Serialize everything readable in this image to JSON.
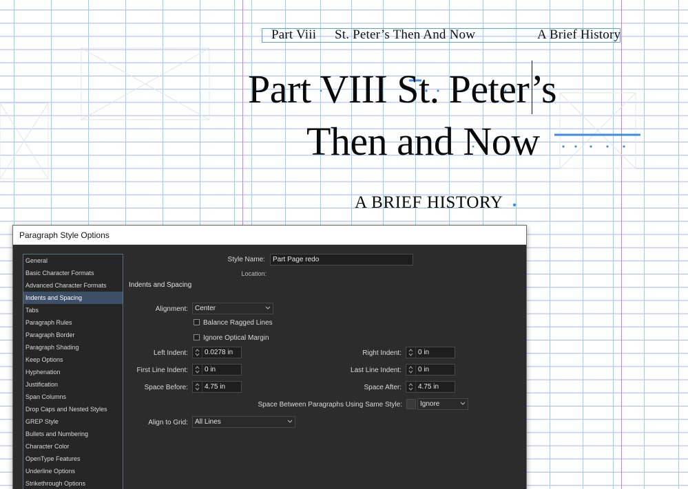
{
  "document": {
    "running_header": {
      "left": "Part Viii",
      "center": "St. Peter’s Then And Now",
      "right": "A Brief History"
    },
    "title_line_1": "Part VIII   St. Peter’s",
    "title_line_2": "Then and Now",
    "subtitle": "A BRIEF HISTORY",
    "colors": {
      "guide_cyan": "#8fd6ee",
      "guide_blue": "#9aa8f0",
      "margin_magenta": "#c685c6",
      "selection_blue": "#3b8de6"
    }
  },
  "dialog": {
    "title": "Paragraph Style Options",
    "sidebar": {
      "items": [
        "General",
        "Basic Character Formats",
        "Advanced Character Formats",
        "Indents and Spacing",
        "Tabs",
        "Paragraph Rules",
        "Paragraph Border",
        "Paragraph Shading",
        "Keep Options",
        "Hyphenation",
        "Justification",
        "Span Columns",
        "Drop Caps and Nested Styles",
        "GREP Style",
        "Bullets and Numbering",
        "Character Color",
        "OpenType Features",
        "Underline Options",
        "Strikethrough Options"
      ],
      "selected": "Indents and Spacing"
    },
    "style_name_label": "Style Name:",
    "style_name_value": "Part Page redo",
    "location_label": "Location:",
    "section_title": "Indents and Spacing",
    "alignment_label": "Alignment:",
    "alignment_value": "Center",
    "balance_ragged_lines": {
      "label": "Balance Ragged Lines",
      "checked": false
    },
    "ignore_optical_margin": {
      "label": "Ignore Optical Margin",
      "checked": false
    },
    "left_indent": {
      "label": "Left Indent:",
      "value": "0.0278 in"
    },
    "right_indent": {
      "label": "Right Indent:",
      "value": "0 in"
    },
    "first_line_indent": {
      "label": "First Line Indent:",
      "value": "0 in"
    },
    "last_line_indent": {
      "label": "Last Line Indent:",
      "value": "0 in"
    },
    "space_before": {
      "label": "Space Before:",
      "value": "4.75 in"
    },
    "space_after": {
      "label": "Space After:",
      "value": "4.75 in"
    },
    "space_between": {
      "label": "Space Between Paragraphs Using Same Style:",
      "value": "Ignore"
    },
    "align_to_grid": {
      "label": "Align to Grid:",
      "value": "All Lines"
    }
  }
}
